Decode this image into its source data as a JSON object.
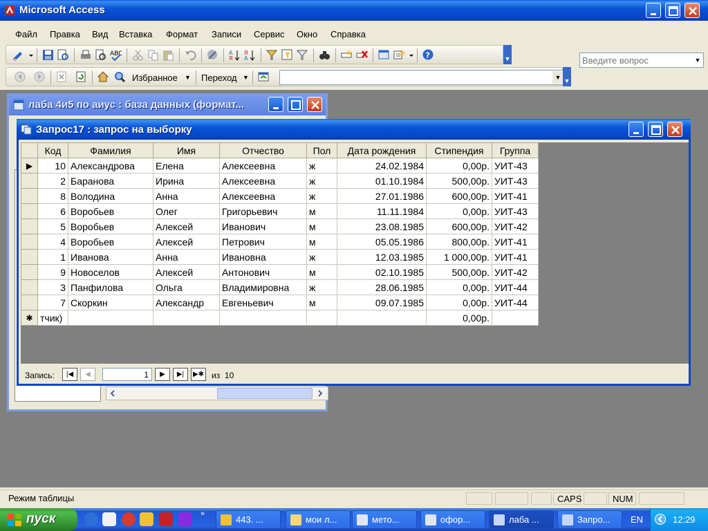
{
  "app": {
    "title": "Microsoft Access"
  },
  "menu": {
    "items": [
      "Файл",
      "Правка",
      "Вид",
      "Вставка",
      "Формат",
      "Записи",
      "Сервис",
      "Окно",
      "Справка"
    ],
    "help_placeholder": "Введите вопрос"
  },
  "web_toolbar": {
    "favorites": "Избранное",
    "goto": "Переход"
  },
  "db_window": {
    "title": "лаба 4и5 по аиус : база данных (формат..."
  },
  "query_window": {
    "title": "Запрос17 : запрос на выборку",
    "columns": [
      "Код",
      "Фамилия",
      "Имя",
      "Отчество",
      "Пол",
      "Дата рождения",
      "Стипендия",
      "Группа"
    ],
    "rows": [
      [
        "10",
        "Александрова",
        "Елена",
        "Алексеевна",
        "ж",
        "24.02.1984",
        "0,00р.",
        "УИТ-43"
      ],
      [
        "2",
        "Баранова",
        "Ирина",
        "Алексеевна",
        "ж",
        "01.10.1984",
        "500,00р.",
        "УИТ-43"
      ],
      [
        "8",
        "Володина",
        "Анна",
        "Алексеевна",
        "ж",
        "27.01.1986",
        "600,00р.",
        "УИТ-41"
      ],
      [
        "6",
        "Воробьев",
        "Олег",
        "Григорьевич",
        "м",
        "11.11.1984",
        "0,00р.",
        "УИТ-43"
      ],
      [
        "5",
        "Воробьев",
        "Алексей",
        "Иванович",
        "м",
        "23.08.1985",
        "600,00р.",
        "УИТ-42"
      ],
      [
        "4",
        "Воробьев",
        "Алексей",
        "Петрович",
        "м",
        "05.05.1986",
        "800,00р.",
        "УИТ-41"
      ],
      [
        "1",
        "Иванова",
        "Анна",
        "Ивановна",
        "ж",
        "12.03.1985",
        "1 000,00р.",
        "УИТ-41"
      ],
      [
        "9",
        "Новоселов",
        "Алексей",
        "Антонович",
        "м",
        "02.10.1985",
        "500,00р.",
        "УИТ-42"
      ],
      [
        "3",
        "Панфилова",
        "Ольга",
        "Владимировна",
        "ж",
        "28.06.1985",
        "0,00р.",
        "УИТ-44"
      ],
      [
        "7",
        "Скоркин",
        "Александр",
        "Евгеньевич",
        "м",
        "09.07.1985",
        "0,00р.",
        "УИТ-44"
      ]
    ],
    "new_row": {
      "code": "тчик)",
      "stipend": "0,00р."
    },
    "nav": {
      "label": "Запись:",
      "current": "1",
      "of_label": "из",
      "total": "10"
    }
  },
  "status": {
    "mode": "Режим таблицы",
    "caps": "CAPS",
    "num": "NUM"
  },
  "taskbar": {
    "start": "пуск",
    "tasks": [
      "443. ...",
      "мои л...",
      "мето...",
      "офор...",
      "лаба ...",
      "Запро..."
    ],
    "lang": "EN",
    "clock": "12:29"
  },
  "colors": {
    "xp_blue": "#0a55d6",
    "start_green": "#3c9c3c",
    "face": "#ece9d8"
  }
}
